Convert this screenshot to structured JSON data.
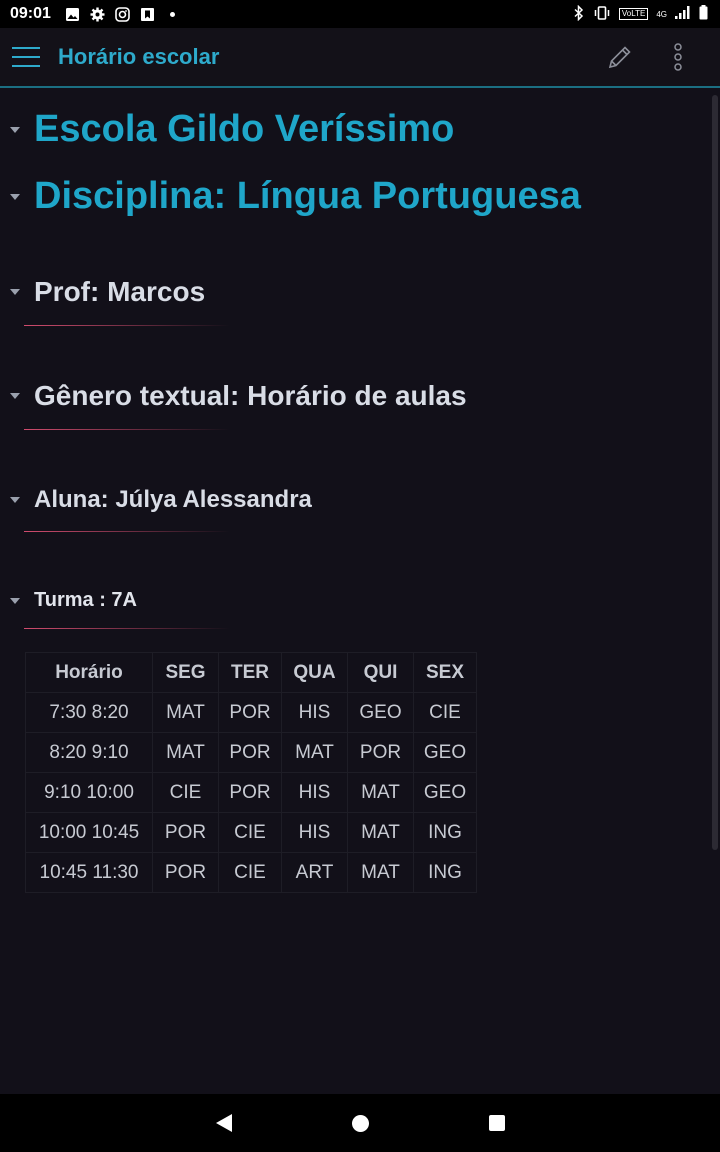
{
  "status_bar": {
    "time": "09:01",
    "network": "4G",
    "volte": "VoLTE",
    "left_icons": [
      "image-icon",
      "gear-icon",
      "instagram-icon",
      "bookmark-app-icon",
      "dot-icon"
    ],
    "right_icons": [
      "bluetooth-icon",
      "vibrate-icon",
      "volte-icon",
      "signal-icon",
      "battery-icon"
    ]
  },
  "app_bar": {
    "title": "Horário escolar",
    "accent": "#2eaacb"
  },
  "document": {
    "school": "Escola Gildo Veríssimo",
    "subject": "Disciplina: Língua Portuguesa",
    "teacher": "Prof: Marcos",
    "genre": "Gênero textual: Horário de aulas",
    "student": "Aluna: Júlya Alessandra",
    "class_group": "Turma : 7A"
  },
  "schedule": {
    "headers": [
      "Horário",
      "SEG",
      "TER",
      "QUA",
      "QUI",
      "SEX"
    ],
    "rows": [
      [
        "7:30 8:20",
        "MAT",
        "POR",
        "HIS",
        "GEO",
        "CIE"
      ],
      [
        "8:20 9:10",
        "MAT",
        "POR",
        "MAT",
        "POR",
        "GEO"
      ],
      [
        "9:10 10:00",
        "CIE",
        "POR",
        "HIS",
        "MAT",
        "GEO"
      ],
      [
        "10:00 10:45",
        "POR",
        "CIE",
        "HIS",
        "MAT",
        "ING"
      ],
      [
        "10:45 11:30",
        "POR",
        "CIE",
        "ART",
        "MAT",
        "ING"
      ]
    ]
  },
  "colors": {
    "background": "#121019",
    "heading_primary": "#1fa6c9",
    "rule": "#d14c6e"
  }
}
